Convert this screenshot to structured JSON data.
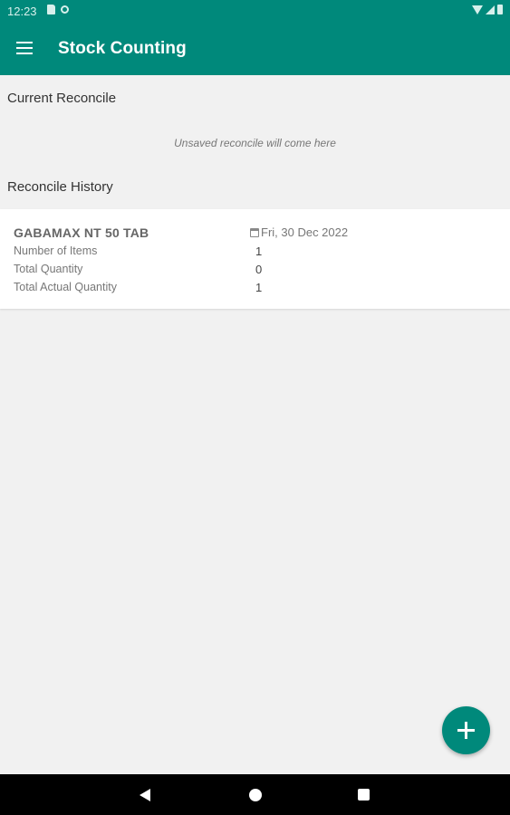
{
  "status_bar": {
    "time": "12:23",
    "icons": [
      "sim-card-icon",
      "sync-icon",
      "wifi-icon",
      "signal-icon",
      "battery-icon"
    ]
  },
  "app_bar": {
    "title": "Stock Counting",
    "menu_icon": "hamburger-menu-icon",
    "color": "#00897b"
  },
  "current_reconcile": {
    "heading": "Current Reconcile",
    "empty_message": "Unsaved reconcile will come here"
  },
  "history": {
    "heading": "Reconcile History",
    "items": [
      {
        "title": "GABAMAX NT 50 TAB",
        "date": "Fri, 30 Dec 2022",
        "rows": [
          {
            "label": "Number of Items",
            "value": "1"
          },
          {
            "label": "Total Quantity",
            "value": "0"
          },
          {
            "label": "Total Actual Quantity",
            "value": "1"
          }
        ]
      }
    ]
  },
  "fab": {
    "icon": "plus-icon"
  },
  "nav_bar": {
    "icons": [
      "back-icon",
      "home-icon",
      "recents-icon"
    ]
  }
}
